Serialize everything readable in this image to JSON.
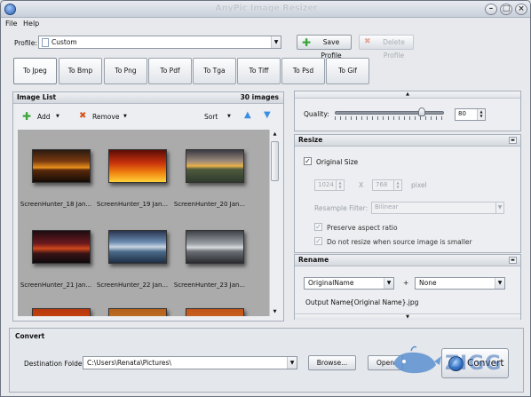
{
  "window": {
    "title": "AnyPic Image Resizer"
  },
  "menu": [
    {
      "label": "File"
    },
    {
      "label": "Help"
    }
  ],
  "profile": {
    "label": "Profile:",
    "value": "Custom",
    "save_label": "Save Profile",
    "delete_label": "Delete Profile"
  },
  "format_tabs": [
    "To Jpeg",
    "To Bmp",
    "To Png",
    "To Pdf",
    "To Tga",
    "To Tiff",
    "To Psd",
    "To Gif"
  ],
  "image_list": {
    "title": "Image List",
    "count": "30 images",
    "add_label": "Add",
    "remove_label": "Remove",
    "sort_label": "Sort",
    "items": [
      {
        "name": "ScreenHunter_18 Jan..."
      },
      {
        "name": "ScreenHunter_19 Jan..."
      },
      {
        "name": "ScreenHunter_20 Jan..."
      },
      {
        "name": "ScreenHunter_21 Jan..."
      },
      {
        "name": "ScreenHunter_22 Jan..."
      },
      {
        "name": "ScreenHunter_23 Jan..."
      }
    ]
  },
  "quality": {
    "label": "Quality:",
    "value": "80",
    "level_percent": 80
  },
  "resize": {
    "title": "Resize",
    "original_size_label": "Original Size",
    "width": "1024",
    "separator": "X",
    "height": "768",
    "unit": "pixel",
    "resample_label": "Resample Filter:",
    "resample_value": "Bilinear",
    "preserve_label": "Preserve aspect ratio",
    "no_resize_label": "Do not resize when source image is smaller"
  },
  "rename": {
    "title": "Rename",
    "first_value": "OriginalName",
    "plus": "+",
    "second_value": "None",
    "output_label": "Output Name:",
    "output_value": "{Original Name}.jpg"
  },
  "convert": {
    "title": "Convert",
    "dest_label": "Destination Folder:",
    "dest_value": "C:\\Users\\Renata\\Pictures\\",
    "browse_label": "Browse...",
    "open_label": "Open",
    "convert_label": "Convert"
  },
  "watermark": {
    "text": "ZIGG"
  },
  "colors": {
    "accent": "#3a78d4",
    "add_green": "#3aa63a",
    "remove_red": "#d9531e"
  }
}
